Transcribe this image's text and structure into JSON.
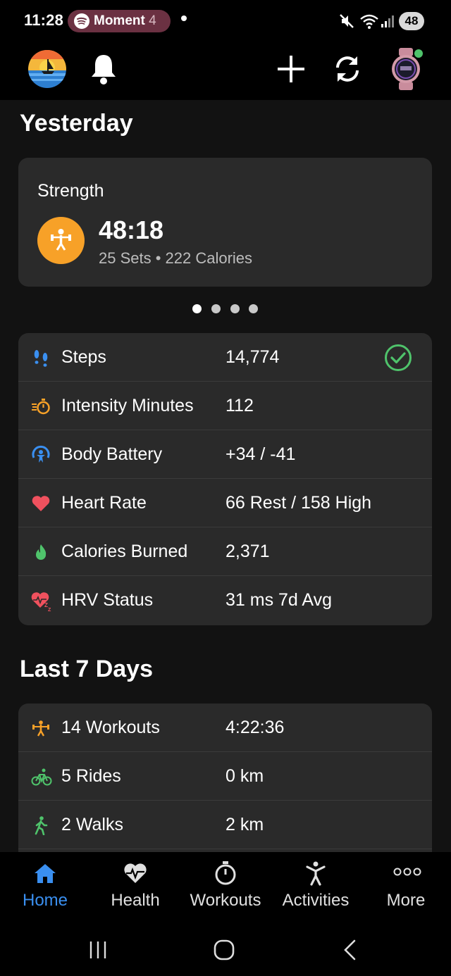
{
  "status_bar": {
    "time": "11:28",
    "media_title": "Moment",
    "media_suffix": "4",
    "battery_level": "48"
  },
  "yesterday": {
    "title": "Yesterday",
    "workout_card": {
      "type": "Strength",
      "duration": "48:18",
      "details": "25 Sets • 222 Calories"
    },
    "pager": {
      "count": 4,
      "active_index": 0
    },
    "stats": [
      {
        "label": "Steps",
        "value": "14,774",
        "icon": "steps-icon",
        "goal_met": true
      },
      {
        "label": "Intensity Minutes",
        "value": "112",
        "icon": "intensity-minutes-icon"
      },
      {
        "label": "Body Battery",
        "value": "+34 / -41",
        "icon": "body-battery-icon"
      },
      {
        "label": "Heart Rate",
        "value": "66 Rest / 158 High",
        "icon": "heart-icon"
      },
      {
        "label": "Calories Burned",
        "value": "2,371",
        "icon": "flame-icon"
      },
      {
        "label": "HRV Status",
        "value": "31 ms 7d Avg",
        "icon": "hrv-heart-icon"
      }
    ]
  },
  "last7": {
    "title": "Last 7 Days",
    "items": [
      {
        "label": "14 Workouts",
        "value": "4:22:36",
        "icon": "strength-icon"
      },
      {
        "label": "5 Rides",
        "value": "0 km",
        "icon": "bike-icon"
      },
      {
        "label": "2 Walks",
        "value": "2 km",
        "icon": "walk-icon"
      }
    ]
  },
  "bottom_nav": [
    {
      "label": "Home",
      "icon": "home-icon",
      "active": true
    },
    {
      "label": "Health",
      "icon": "health-icon",
      "active": false
    },
    {
      "label": "Workouts",
      "icon": "stopwatch-icon",
      "active": false
    },
    {
      "label": "Activities",
      "icon": "activities-icon",
      "active": false
    },
    {
      "label": "More",
      "icon": "more-icon",
      "active": false
    }
  ],
  "colors": {
    "background": "#121212",
    "card": "#2a2a2a",
    "accent_blue": "#3a8ff0",
    "strength_orange": "#f7a128",
    "goal_green": "#4fc36b",
    "heart_red": "#f0515e",
    "pill": "#6b3142"
  }
}
